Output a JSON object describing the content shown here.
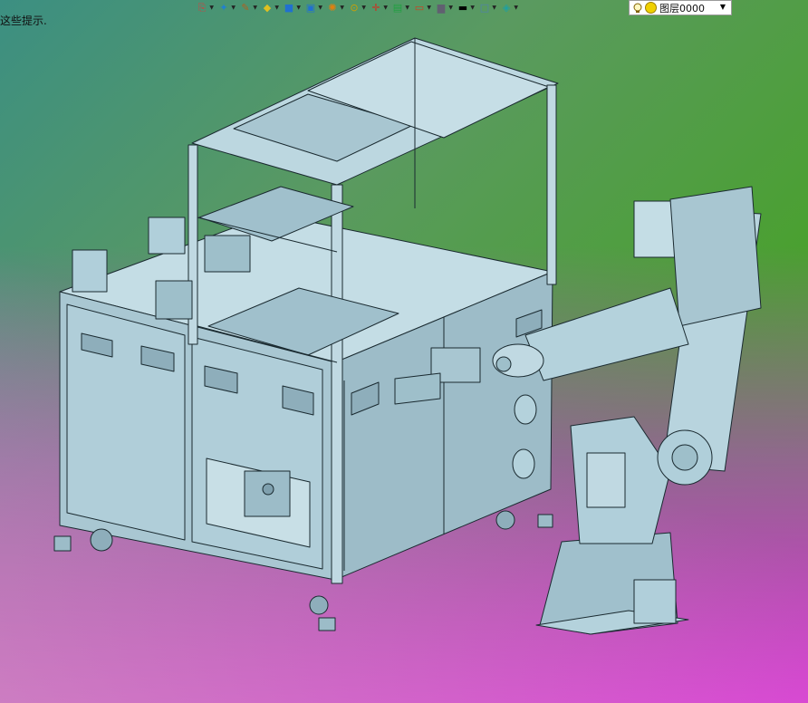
{
  "status": {
    "hint": "这些提示."
  },
  "toolbar": {
    "buttons": [
      {
        "name": "view-orient-icon",
        "glyph": "⎘",
        "color": "#d04040"
      },
      {
        "name": "lamp-icon",
        "glyph": "✦",
        "color": "#2080d0"
      },
      {
        "name": "pencil-icon",
        "glyph": "✎",
        "color": "#b06020"
      },
      {
        "name": "box-yellow-icon",
        "glyph": "◆",
        "color": "#e0c020"
      },
      {
        "name": "cube-icon",
        "glyph": "■",
        "color": "#2070d0"
      },
      {
        "name": "cube-split-icon",
        "glyph": "▣",
        "color": "#2070d0"
      },
      {
        "name": "appearance-icon",
        "glyph": "✺",
        "color": "#e08010"
      },
      {
        "name": "zoom-icon",
        "glyph": "⊙",
        "color": "#d0a000"
      },
      {
        "name": "axes-icon",
        "glyph": "✛",
        "color": "#d03020"
      },
      {
        "name": "display-icon",
        "glyph": "▤",
        "color": "#20a040"
      },
      {
        "name": "section-icon",
        "glyph": "▭",
        "color": "#d04020"
      },
      {
        "name": "monitor-icon",
        "glyph": "▆",
        "color": "#606070"
      },
      {
        "name": "line-style-icon",
        "glyph": "▬",
        "color": "#000000"
      },
      {
        "name": "color-swatch-icon",
        "glyph": "□",
        "color": "#5080b0"
      },
      {
        "name": "layer-stack-icon",
        "glyph": "◈",
        "color": "#20a0a0"
      }
    ],
    "layer": {
      "name": "图层0000"
    }
  },
  "colors": {
    "metal": "#b4d2dc",
    "metal_dark": "#8fb0bc",
    "edge": "#1a2a30"
  }
}
